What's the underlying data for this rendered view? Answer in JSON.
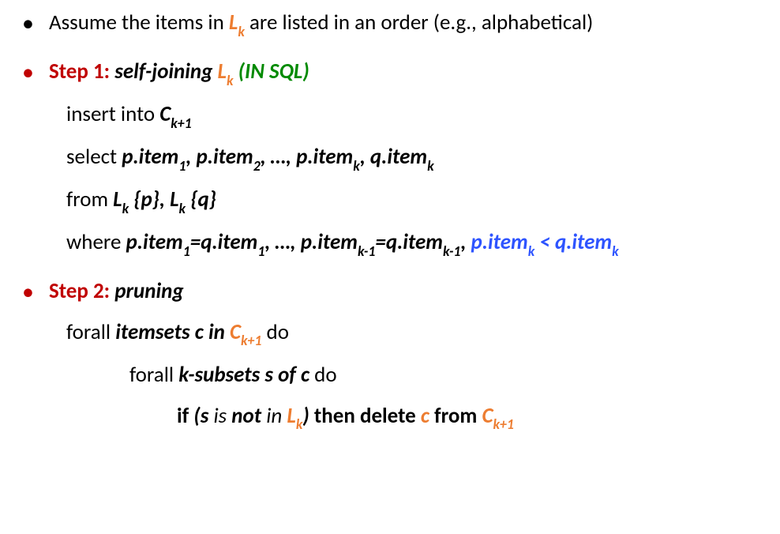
{
  "bullet1": {
    "pre": "Assume the items in ",
    "L": "L",
    "k": "k",
    "post": " are listed in an order (e.g., alphabetical)"
  },
  "step1": {
    "label": "Step 1: ",
    "title1": "self-joining ",
    "L": "L",
    "k": "k",
    "sql": " (IN SQL)",
    "insert_pre": "insert into ",
    "C": "C",
    "kplus1": "k+1",
    "select_pre": "select ",
    "p_item": "p.item",
    "q_item": "q.item",
    "one": "1",
    "two": "2",
    "comma": ", ",
    "ellipsis": "…, ",
    "k_s": "k",
    "from_pre": "from ",
    "pbrace": " {p}",
    "qbrace": "{q}",
    "where_pre": "where ",
    "eq": "=",
    "km1": "k-1",
    "lt": " < ",
    "cond_tail_q": "q.item"
  },
  "step2": {
    "label": "Step 2: ",
    "title": "pruning",
    "forall1_a": "forall ",
    "forall1_b": "itemsets c in ",
    "C": "C",
    "kplus1": "k+1",
    "do": " do",
    "forall2_a": "forall ",
    "forall2_b": "k-subsets s of c",
    "if_a": "if ",
    "if_b1": "(s",
    "if_b2": " is ",
    "if_b3": "not",
    "if_b4": " in ",
    "L": "L",
    "k": "k",
    "if_b5": ")",
    "then": " then delete ",
    "c": "c",
    "from": " from "
  }
}
